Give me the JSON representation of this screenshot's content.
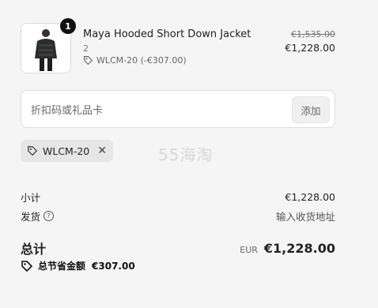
{
  "item": {
    "quantity_badge": "1",
    "name": "Maya Hooded Short Down Jacket",
    "qty": "2",
    "discount_tag": "WLCM-20 (-€307.00)",
    "price_original": "€1,535.00",
    "price_current": "€1,228.00"
  },
  "discount_input": {
    "placeholder": "折扣码或礼品卡",
    "apply_label": "添加"
  },
  "applied_code": {
    "code": "WLCM-20",
    "remove": "✕"
  },
  "watermark": "55海淘",
  "summary": {
    "subtotal_label": "小计",
    "subtotal_value": "€1,228.00",
    "shipping_label": "发货",
    "shipping_value": "输入收货地址",
    "total_label": "总计",
    "currency": "EUR",
    "total_value": "€1,228.00",
    "savings_label": "总节省金额",
    "savings_value": "€307.00"
  }
}
